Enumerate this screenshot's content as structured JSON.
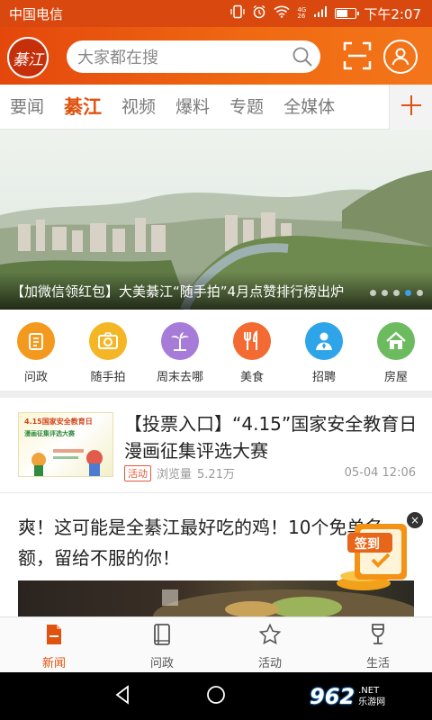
{
  "status_bar": {
    "carrier": "中国电信",
    "time": "下午2:07",
    "network_tag_top": "4G",
    "network_tag_bottom": "26",
    "battery_level": 0.55
  },
  "header": {
    "logo_text": "綦江",
    "search_placeholder": "大家都在搜",
    "icons": [
      "search-icon",
      "scan-icon",
      "user-icon"
    ]
  },
  "tabs": [
    {
      "label": "要闻"
    },
    {
      "label": "綦江"
    },
    {
      "label": "视频"
    },
    {
      "label": "爆料"
    },
    {
      "label": "专题"
    },
    {
      "label": "全媒体"
    }
  ],
  "active_tab": "綦江",
  "banner": {
    "caption": "【加微信领红包】大美綦江“随手拍”4月点赞排行榜出炉",
    "slide_count": 5,
    "active_slide": 4
  },
  "quick_links": [
    {
      "label": "问政",
      "icon": "clipboard-icon",
      "color": "#f39a1e"
    },
    {
      "label": "随手拍",
      "icon": "camera-icon",
      "color": "#f4b625"
    },
    {
      "label": "周末去哪",
      "icon": "palm-tree-icon",
      "color": "#a77bd8"
    },
    {
      "label": "美食",
      "icon": "cutlery-icon",
      "color": "#f36a32"
    },
    {
      "label": "招聘",
      "icon": "person-icon",
      "color": "#2ea5e8"
    },
    {
      "label": "房屋",
      "icon": "house-icon",
      "color": "#6cbb5e"
    }
  ],
  "news": [
    {
      "title": "【投票入口】“4.15”国家安全教育日漫画征集评选大赛",
      "tag": "活动",
      "views_label": "浏览量",
      "views": "5.21万",
      "date": "05-04 12:06",
      "thumb_title": "4.15国家安全教育日",
      "thumb_sub": "漫画征集评选大赛"
    },
    {
      "title": "爽！这可能是全綦江最好吃的鸡！10个免单名额，留给不服的你！"
    }
  ],
  "checkin": {
    "label": "签到",
    "close": "×"
  },
  "bottom_nav": [
    {
      "label": "新闻",
      "icon": "news-icon"
    },
    {
      "label": "问政",
      "icon": "book-icon"
    },
    {
      "label": "活动",
      "icon": "star-icon"
    },
    {
      "label": "生活",
      "icon": "wine-glass-icon"
    }
  ],
  "active_bottom": "新闻",
  "watermark": {
    "number": "962",
    "suffix": ".NET",
    "site": "乐游网"
  },
  "colors": {
    "brand": "#e0520f",
    "header_start": "#e4470c",
    "header_end": "#f3751a"
  }
}
